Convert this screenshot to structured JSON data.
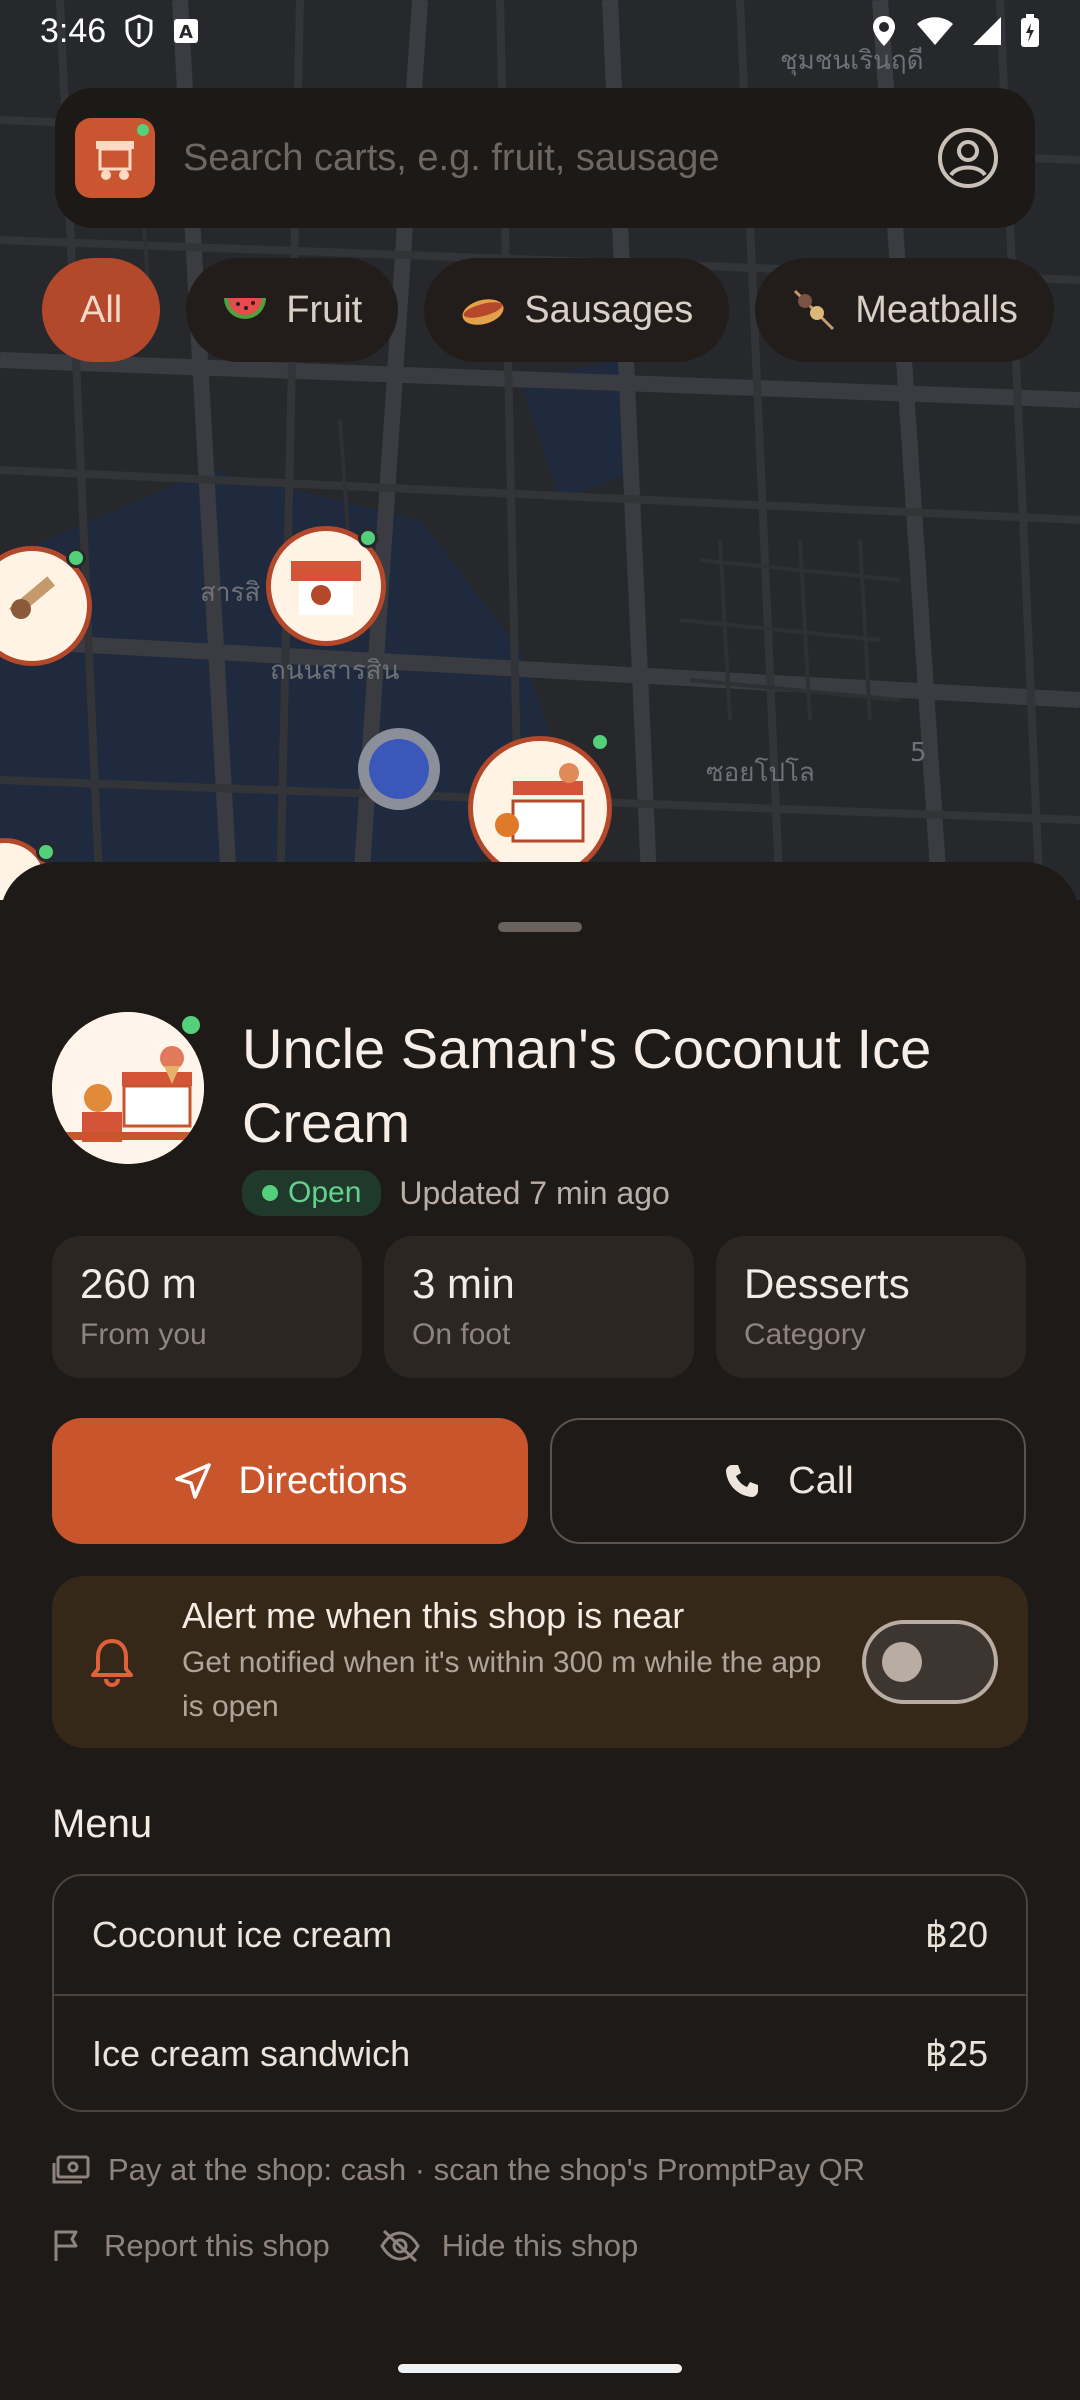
{
  "status_bar": {
    "time": "3:46"
  },
  "search": {
    "placeholder": "Search carts, e.g. fruit, sausage"
  },
  "chips": [
    {
      "label": "All",
      "icon": "none"
    },
    {
      "label": "Fruit",
      "icon": "watermelon-icon"
    },
    {
      "label": "Sausages",
      "icon": "hotdog-icon"
    },
    {
      "label": "Meatballs",
      "icon": "skewer-icon"
    }
  ],
  "map_labels": [
    "ชุมชนเรินฤดี",
    "ถนนสารสิน",
    "ซอยโปโล",
    "5",
    "สารสิ"
  ],
  "shop": {
    "name": "Uncle Saman's Coconut Ice Cream",
    "status": "Open",
    "updated": "Updated 7 min ago",
    "stats": [
      {
        "value": "260 m",
        "label": "From you"
      },
      {
        "value": "3 min",
        "label": "On foot"
      },
      {
        "value": "Desserts",
        "label": "Category"
      }
    ]
  },
  "actions": {
    "directions": "Directions",
    "call": "Call"
  },
  "alert": {
    "title": "Alert me when this shop is near",
    "subtitle": "Get notified when it's within 300 m while the app is open",
    "enabled": false
  },
  "menu": {
    "title": "Menu",
    "items": [
      {
        "name": "Coconut ice cream",
        "price": "฿20"
      },
      {
        "name": "Ice cream sandwich",
        "price": "฿25"
      }
    ]
  },
  "payment": "Pay at the shop: cash · scan the shop's PromptPay QR",
  "links": {
    "report": "Report this shop",
    "hide": "Hide this shop"
  },
  "colors": {
    "accent": "#c9552d",
    "online": "#55d07a",
    "sheet": "#1e1a17"
  }
}
